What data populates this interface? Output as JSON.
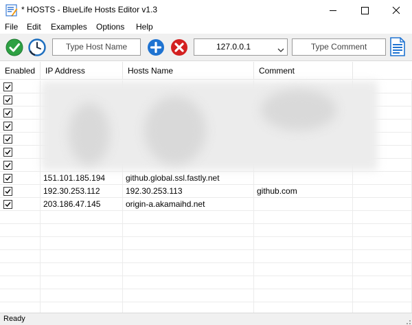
{
  "window": {
    "title": "* HOSTS - BlueLife Hosts Editor v1.3"
  },
  "menu": {
    "items": [
      "File",
      "Edit",
      "Examples",
      "Options",
      "Help"
    ]
  },
  "toolbar": {
    "host_name_placeholder": "Type Host Name",
    "ip_value": "127.0.0.1",
    "comment_placeholder": "Type Comment",
    "icons": [
      "check-save-icon",
      "clock-history-icon",
      "add-icon",
      "delete-icon",
      "notes-document-icon"
    ],
    "colors": {
      "save": "#2ea043",
      "history": "#1e6fbf",
      "add": "#1f73d1",
      "delete": "#d32020",
      "notes": "#1f73d1"
    }
  },
  "table": {
    "columns": [
      "Enabled",
      "IP Address",
      "Hosts Name",
      "Comment"
    ],
    "rows": [
      {
        "enabled": true,
        "ip": "",
        "host": "",
        "comment": ""
      },
      {
        "enabled": true,
        "ip": "",
        "host": "",
        "comment": ""
      },
      {
        "enabled": true,
        "ip": "",
        "host": "",
        "comment": ""
      },
      {
        "enabled": true,
        "ip": "",
        "host": "",
        "comment": ""
      },
      {
        "enabled": true,
        "ip": "",
        "host": "",
        "comment": ""
      },
      {
        "enabled": true,
        "ip": "",
        "host": "",
        "comment": ""
      },
      {
        "enabled": true,
        "ip": "",
        "host": "",
        "comment": ""
      },
      {
        "enabled": true,
        "ip": "151.101.185.194",
        "host": "github.global.ssl.fastly.net",
        "comment": ""
      },
      {
        "enabled": true,
        "ip": "192.30.253.112",
        "host": "192.30.253.113",
        "comment": "github.com"
      },
      {
        "enabled": true,
        "ip": "203.186.47.145",
        "host": "origin-a.akamaihd.net",
        "comment": ""
      }
    ]
  },
  "status": {
    "text": "Ready"
  }
}
